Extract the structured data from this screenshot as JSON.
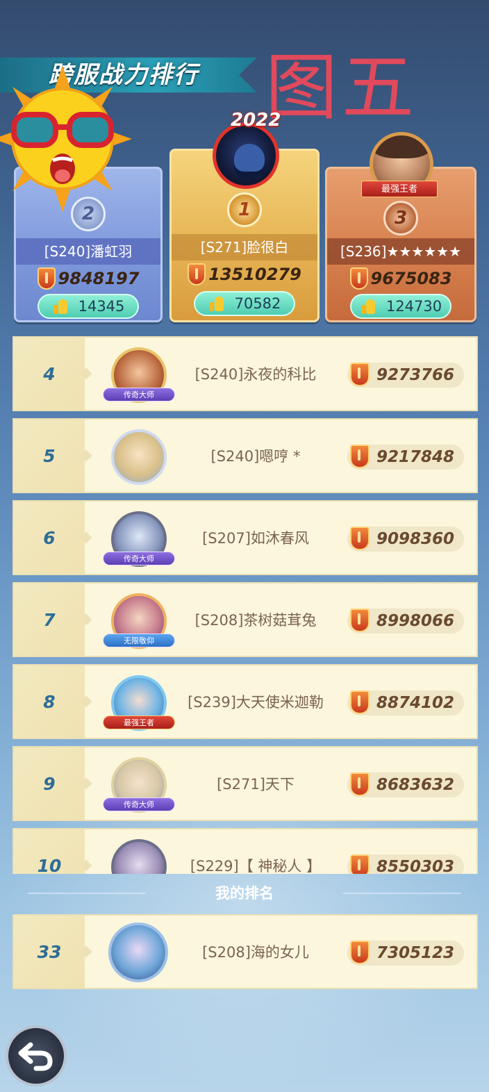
{
  "header": {
    "title": "跨服战力排行",
    "stamp": "图五"
  },
  "podium": [
    {
      "rank": "2",
      "name": "[S240]潘虹羽",
      "power": "9848197",
      "likes": "14345"
    },
    {
      "rank": "1",
      "name": "[S271]脸很白",
      "power": "13510279",
      "likes": "70582",
      "year_tag": "2022"
    },
    {
      "rank": "3",
      "name": "[S236]★★★★★★",
      "power": "9675083",
      "likes": "124730",
      "title_tag": "最强王者"
    }
  ],
  "rows": [
    {
      "rank": "4",
      "name": "[S240]永夜的科比",
      "power": "9273766",
      "badge": "传奇大师"
    },
    {
      "rank": "5",
      "name": "[S240]嗯哼 *",
      "power": "9217848",
      "badge": ""
    },
    {
      "rank": "6",
      "name": "[S207]如沐春风",
      "power": "9098360",
      "badge": "传奇大师"
    },
    {
      "rank": "7",
      "name": "[S208]茶树菇茸兔",
      "power": "8998066",
      "badge": "无限敬仰"
    },
    {
      "rank": "8",
      "name": "[S239]大天使米迦勒",
      "power": "8874102",
      "badge": "最强王者"
    },
    {
      "rank": "9",
      "name": "[S271]天下",
      "power": "8683632",
      "badge": "传奇大师"
    },
    {
      "rank": "10",
      "name": "[S229]【 神秘人 】",
      "power": "8550303",
      "badge": ""
    }
  ],
  "my_rank": {
    "label": "我的排名",
    "rank": "33",
    "name": "[S208]海的女儿",
    "power": "7305123"
  },
  "icons": {
    "back": "back-arrow-icon",
    "like": "thumbs-up-icon",
    "power": "shield-sword-icon"
  },
  "colors": {
    "row_bg": "#fbf6dc",
    "rank_text": "#2e6d97",
    "stamp": "#e04a5c",
    "like_pill": "#4fcdb2"
  }
}
